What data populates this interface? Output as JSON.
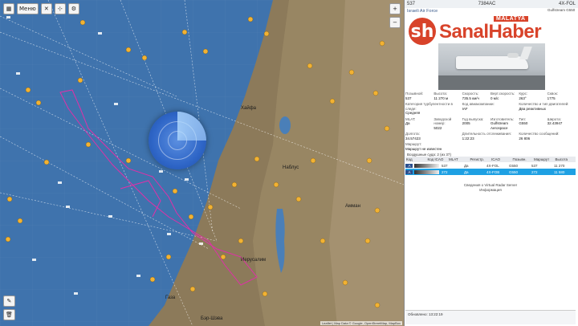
{
  "map": {
    "menu_label": "Меню",
    "zoom_in": "+",
    "zoom_out": "−",
    "attribution": "Leaflet | Map Data © Google, OpenStreetMap, MapBox",
    "labels": [
      "Хайфа",
      "Наблус",
      "Иерусалим",
      "Амман",
      "Газа",
      "Бэр-Шэва"
    ]
  },
  "panel": {
    "callsign": "537",
    "hex": "7384AC",
    "operator": "Israeli Air Force",
    "side_code": "4X-FOL",
    "side_text": "Gulfstream G550",
    "fields": [
      {
        "k": "Позывной:",
        "v": "537"
      },
      {
        "k": "Высота:",
        "v": "11 270 м"
      },
      {
        "k": "Скорость:",
        "v": "735.5 км/ч"
      },
      {
        "k": "Верт.скорость:",
        "v": "0 м/с"
      },
      {
        "k": "Курс:",
        "v": "263°"
      },
      {
        "k": "Сквок:",
        "v": "1775"
      },
      {
        "k": "Категория турбулентности в следе:",
        "v": "Средняя"
      },
      {
        "k": "Код авиакомпании:",
        "v": "IAF"
      },
      {
        "k": "Количество и тип двигателей:",
        "v": "Два реактивных"
      },
      {
        "k": "MLAT:",
        "v": "Да"
      },
      {
        "k": "Заводской номер:",
        "v": "5022"
      },
      {
        "k": "Год выпуска:",
        "v": "2005"
      },
      {
        "k": "Изготовитель:",
        "v": "Gulfstream Aerospace"
      },
      {
        "k": "Тип:",
        "v": "G550"
      },
      {
        "k": "Широта:",
        "v": "32.43947"
      },
      {
        "k": "Долгота:",
        "v": "34.57423"
      },
      {
        "k": "Длительность отслеживания:",
        "v": "1:22:23"
      },
      {
        "k": "Количество сообщений:",
        "v": "26 806"
      },
      {
        "k": "Маршрут:",
        "v": "Маршрут не известен"
      }
    ],
    "table_title": "Воздушные суда: 2 (из 37)",
    "table_headers": [
      "Код",
      "Код ICAO",
      "MLAT",
      "Регистр.",
      "ICAO",
      "Позывн.",
      "Маршрут",
      "Высота"
    ],
    "rows": [
      {
        "tag": "A",
        "c": [
          "537",
          "Да",
          "4X-FOL",
          "G550",
          "537",
          "",
          "11 270"
        ],
        "sel": false
      },
      {
        "tag": "A",
        "c": [
          "272",
          "Да",
          "4X-FOB",
          "G550",
          "272",
          "",
          "11 580"
        ],
        "sel": true
      }
    ],
    "footer_lines": [
      "Сведения о Virtual Radar Server",
      "Информация"
    ],
    "status": "Обновлено: 13:22:19"
  },
  "logo": {
    "mark": "sh",
    "name": "SanalHaber",
    "tag": "MALATYA"
  }
}
